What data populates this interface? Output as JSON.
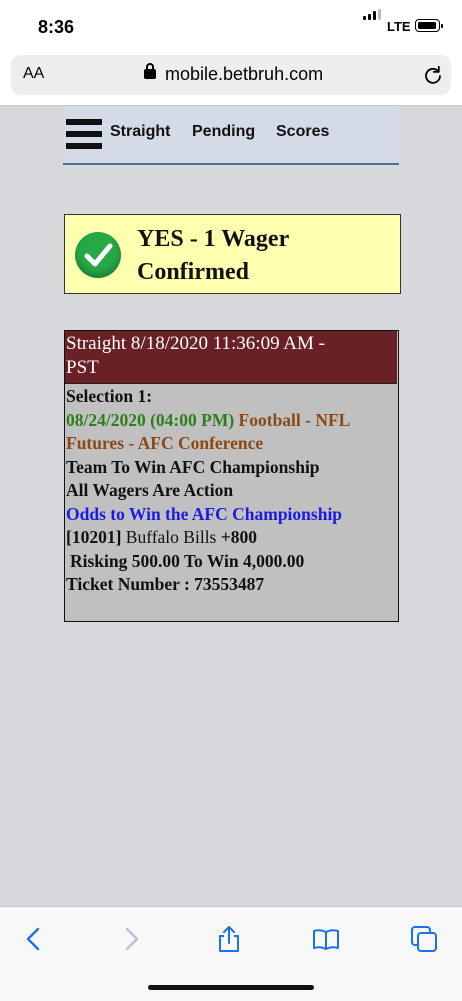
{
  "status": {
    "time": "8:36",
    "network": "LTE"
  },
  "browser": {
    "aa_label": "AA",
    "url": "mobile.betbruh.com"
  },
  "nav": {
    "items": [
      {
        "label": "Straight"
      },
      {
        "label": "Pending"
      },
      {
        "label": "Scores"
      }
    ]
  },
  "confirmation": {
    "line1": "YES - 1 Wager",
    "line2": "Confirmed"
  },
  "wager": {
    "header_line1": "Straight    8/18/2020 11:36:09 AM -",
    "header_line2": "PST",
    "selection_label": "Selection 1:",
    "date_part": "08/24/2020 (04:00 PM)",
    "sport_part1": "Football - NFL",
    "sport_part2": "Futures - AFC Conference",
    "market": "Team To Win AFC Championship",
    "action_note": "All Wagers Are Action",
    "odds_title": "Odds to Win the AFC Championship",
    "team_id": "[10201]",
    "team_name": "Buffalo Bills",
    "team_odds": "+800",
    "risk_line": "Risking 500.00 To Win 4,000.00",
    "ticket_line": "Ticket Number : 73553487"
  },
  "colors": {
    "header_bg": "#6a2125",
    "confirm_bg": "#ffffb0",
    "check_green": "#25a845",
    "ios_blue": "#1a73e8"
  }
}
